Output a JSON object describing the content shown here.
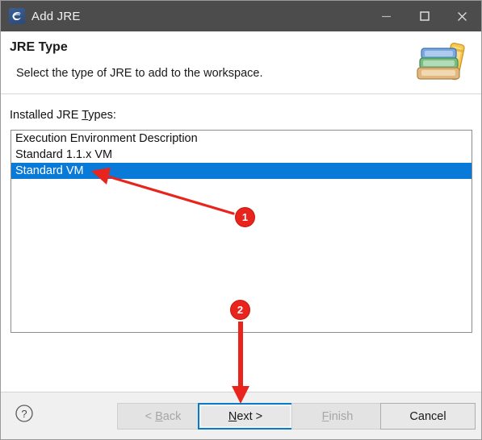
{
  "window": {
    "title": "Add JRE",
    "app_icon": "eclipse-icon",
    "controls": [
      {
        "name": "minimize-button",
        "glyph": "minimize-icon"
      },
      {
        "name": "maximize-button",
        "glyph": "maximize-icon"
      },
      {
        "name": "close-button",
        "glyph": "close-icon"
      }
    ]
  },
  "header": {
    "title": "JRE Type",
    "subtitle": "Select the type of JRE to add to the workspace.",
    "banner_icon": "books-icon"
  },
  "content": {
    "list_label_prefix": "Installed JRE ",
    "list_label_mnemonic": "T",
    "list_label_suffix": "ypes:",
    "list_items": [
      {
        "label": "Execution Environment Description",
        "selected": false
      },
      {
        "label": "Standard 1.1.x VM",
        "selected": false
      },
      {
        "label": "Standard VM",
        "selected": true
      }
    ]
  },
  "footer": {
    "help_icon": "help-question-icon",
    "buttons": [
      {
        "name": "back-button",
        "label": "< Back",
        "mnemonic": "B",
        "enabled": false,
        "focused": false
      },
      {
        "name": "next-button",
        "label": "Next >",
        "mnemonic": "N",
        "enabled": true,
        "focused": true
      },
      {
        "name": "finish-button",
        "label": "Finish",
        "mnemonic": "F",
        "enabled": false,
        "focused": false
      },
      {
        "name": "cancel-button",
        "label": "Cancel",
        "mnemonic": "",
        "enabled": true,
        "focused": false
      }
    ],
    "back_label": "< Back",
    "next_label": "Next >",
    "finish_label": "Finish",
    "cancel_label": "Cancel"
  },
  "annotations": {
    "badge_1": "1",
    "badge_2": "2",
    "arrow_color": "#e8241c",
    "badge_color": "#e8241c"
  },
  "colors": {
    "titlebar": "#4c4c4c",
    "selection": "#0a7ad8",
    "focus_border": "#0b7ac6",
    "dialog_bg": "#ffffff",
    "footer_bg": "#f0f0f0"
  }
}
